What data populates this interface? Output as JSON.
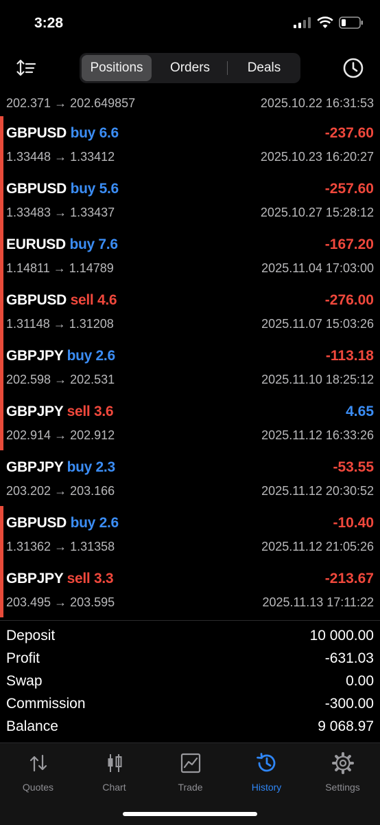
{
  "status": {
    "time": "3:28"
  },
  "tabs": {
    "positions": "Positions",
    "orders": "Orders",
    "deals": "Deals"
  },
  "partial_row": {
    "prices": "202.371 → 202.649857",
    "time": "2025.10.22 16:31:53"
  },
  "deals": [
    {
      "symbol": "GBPUSD",
      "side": "buy 6.6",
      "prices": "1.33448 → 1.33412",
      "profit": "-237.60",
      "time": "2025.10.23 16:20:27"
    },
    {
      "symbol": "GBPUSD",
      "side": "buy 5.6",
      "prices": "1.33483 → 1.33437",
      "profit": "-257.60",
      "time": "2025.10.27 15:28:12"
    },
    {
      "symbol": "EURUSD",
      "side": "buy 7.6",
      "prices": "1.14811 → 1.14789",
      "profit": "-167.20",
      "time": "2025.11.04 17:03:00"
    },
    {
      "symbol": "GBPUSD",
      "side": "sell 4.6",
      "prices": "1.31148 → 1.31208",
      "profit": "-276.00",
      "time": "2025.11.07 15:03:26"
    },
    {
      "symbol": "GBPJPY",
      "side": "buy 2.6",
      "prices": "202.598 → 202.531",
      "profit": "-113.18",
      "time": "2025.11.10 18:25:12"
    },
    {
      "symbol": "GBPJPY",
      "side": "sell 3.6",
      "prices": "202.914 → 202.912",
      "profit": "4.65",
      "time": "2025.11.12 16:33:26"
    },
    {
      "symbol": "GBPJPY",
      "side": "buy 2.3",
      "prices": "203.202 → 203.166",
      "profit": "-53.55",
      "time": "2025.11.12 20:30:52"
    },
    {
      "symbol": "GBPUSD",
      "side": "buy 2.6",
      "prices": "1.31362 → 1.31358",
      "profit": "-10.40",
      "time": "2025.11.12 21:05:26"
    },
    {
      "symbol": "GBPJPY",
      "side": "sell 3.3",
      "prices": "203.495 → 203.595",
      "profit": "-213.67",
      "time": "2025.11.13 17:11:22"
    }
  ],
  "summary": {
    "deposit_label": "Deposit",
    "deposit": "10 000.00",
    "profit_label": "Profit",
    "profit": "-631.03",
    "swap_label": "Swap",
    "swap": "0.00",
    "commission_label": "Commission",
    "commission": "-300.00",
    "balance_label": "Balance",
    "balance": "9 068.97"
  },
  "tabbar": {
    "quotes": "Quotes",
    "chart": "Chart",
    "trade": "Trade",
    "history": "History",
    "settings": "Settings"
  },
  "colors": {
    "buy": "#3b8df5",
    "sell": "#f0483c",
    "active_tab": "#2f86f6",
    "marker": "#e84b3a"
  }
}
